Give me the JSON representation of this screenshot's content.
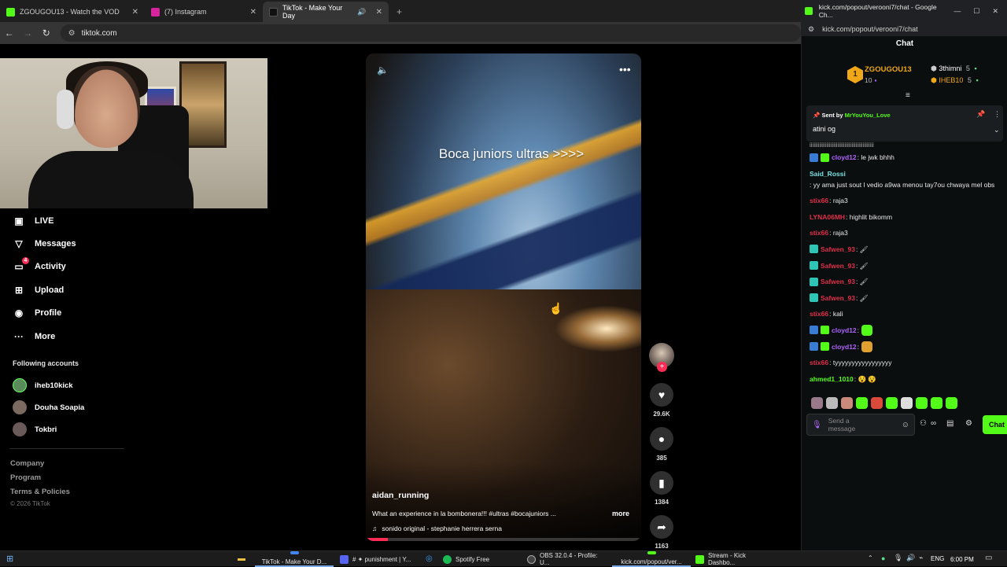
{
  "browser": {
    "tabs": [
      {
        "title": "ZGOUGOU13 - Watch the VOD",
        "color": "#53fc18"
      },
      {
        "title": "(7) Instagram",
        "color": "#d6249f"
      },
      {
        "title": "TikTok - Make Your Day",
        "color": "#111111"
      }
    ],
    "url": "tiktok.com"
  },
  "sidebar": {
    "items": [
      {
        "label": "LIVE",
        "icon": "live-icon"
      },
      {
        "label": "Messages",
        "icon": "messages-icon"
      },
      {
        "label": "Activity",
        "icon": "activity-icon",
        "badge": "4"
      },
      {
        "label": "Upload",
        "icon": "upload-icon"
      },
      {
        "label": "Profile",
        "icon": "profile-icon"
      },
      {
        "label": "More",
        "icon": "more-icon"
      }
    ],
    "following_title": "Following accounts",
    "following": [
      {
        "name": "iheb10kick",
        "color": "#5a8a5a"
      },
      {
        "name": "Douha Soapia",
        "color": "#7a6a60"
      },
      {
        "name": "Tokbri",
        "color": "#6a5a5a"
      }
    ],
    "footer": [
      "Company",
      "Program",
      "Terms & Policies"
    ],
    "copyright": "© 2026 TikTok"
  },
  "video": {
    "overlay_title": "Boca juniors ultras >>>>",
    "author": "aidan_running",
    "caption": "What an experience in la bombonera!!! #ultras #bocajuniors ...",
    "more": "more",
    "sound": "sonido original - stephanie herrera serna",
    "progress": 0.08,
    "counts": {
      "likes": "29.6K",
      "comments": "385",
      "saves": "1384",
      "shares": "1163"
    }
  },
  "chat": {
    "window_title": "kick.com/popout/verooni7/chat - Google Ch...",
    "url": "kick.com/popout/verooni7/chat",
    "header": "Chat",
    "leaderboard": [
      {
        "rank": "1",
        "name": "ZGOUGOU13",
        "count": "10"
      },
      {
        "name": "3thimni",
        "count": "5"
      },
      {
        "name": "IHEB10",
        "count": "5"
      }
    ],
    "pinned": {
      "sent_by": "Sent by",
      "user": "MrYouYou_Love",
      "text": "atini og"
    },
    "scroll_peek": "iiiiiiiiiiiiiiiiiiiiiiiiiiiiiiiiiiiiiiiiiiiiii",
    "messages": [
      {
        "user": "cloyd12",
        "color": "#b065ff",
        "text": ": le jwk bhhh",
        "badges": [
          "#3a7bd5",
          "#53fc18"
        ]
      },
      {
        "user": "Said_Rossi",
        "color": "#7ae0e0",
        "text": ": yy ama just sout l vedio a9wa menou tay7ou chwaya mel obs",
        "badges": []
      },
      {
        "user": "stix66",
        "color": "#e0304a",
        "text": ": raja3",
        "badges": []
      },
      {
        "user": "LYNA06MH",
        "color": "#e0304a",
        "text": ": highlit bikomm",
        "badges": []
      },
      {
        "user": "stix66",
        "color": "#e0304a",
        "text": ": raja3",
        "badges": []
      },
      {
        "user": "Safwen_93",
        "color": "#e0304a",
        "text": ": 🖌",
        "badges": [
          "#2ec4b6"
        ]
      },
      {
        "user": "Safwen_93",
        "color": "#e0304a",
        "text": ": 🖌",
        "badges": [
          "#2ec4b6"
        ]
      },
      {
        "user": "Safwen_93",
        "color": "#e0304a",
        "text": ": 🖌",
        "badges": [
          "#2ec4b6"
        ]
      },
      {
        "user": "Safwen_93",
        "color": "#e0304a",
        "text": ": 🖌",
        "badges": [
          "#2ec4b6"
        ]
      },
      {
        "user": "stix66",
        "color": "#e0304a",
        "text": ": kali",
        "badges": []
      },
      {
        "user": "cloyd12",
        "color": "#b065ff",
        "text": ":",
        "badges": [
          "#3a7bd5",
          "#53fc18"
        ],
        "emote": "#53fc18"
      },
      {
        "user": "cloyd12",
        "color": "#b065ff",
        "text": ":",
        "badges": [
          "#3a7bd5",
          "#53fc18"
        ],
        "emote": "#e0a030"
      },
      {
        "user": "stix66",
        "color": "#e0304a",
        "text": ": tyyyyyyyyyyyyyyyyy",
        "badges": []
      },
      {
        "user": "ahmed1_1010",
        "color": "#53fc18",
        "text": ": 😵 😵",
        "badges": []
      }
    ],
    "emote_bar": [
      "#9a7a8a",
      "#bbbbbb",
      "#c98a7a",
      "#53fc18",
      "#d94a3a",
      "#53fc18",
      "#dddddd",
      "#53fc18",
      "#53fc18",
      "#53fc18"
    ],
    "input_placeholder": "Send a message",
    "send_label": "Chat"
  },
  "taskbar": {
    "items": [
      {
        "label": "TikTok - Make Your D...",
        "color": "#4285f4"
      },
      {
        "label": "# ✦ punishment | Y...",
        "color": "#5865f2"
      },
      {
        "label": "Spotify Free",
        "color": "#1db954"
      },
      {
        "label": "OBS 32.0.4 - Profile: U...",
        "color": "#444444"
      },
      {
        "label": "kick.com/popout/ver...",
        "color": "#53fc18"
      },
      {
        "label": "Stream - Kick Dashbo...",
        "color": "#53fc18"
      }
    ],
    "lang": "ENG",
    "time": "6:00 PM"
  }
}
